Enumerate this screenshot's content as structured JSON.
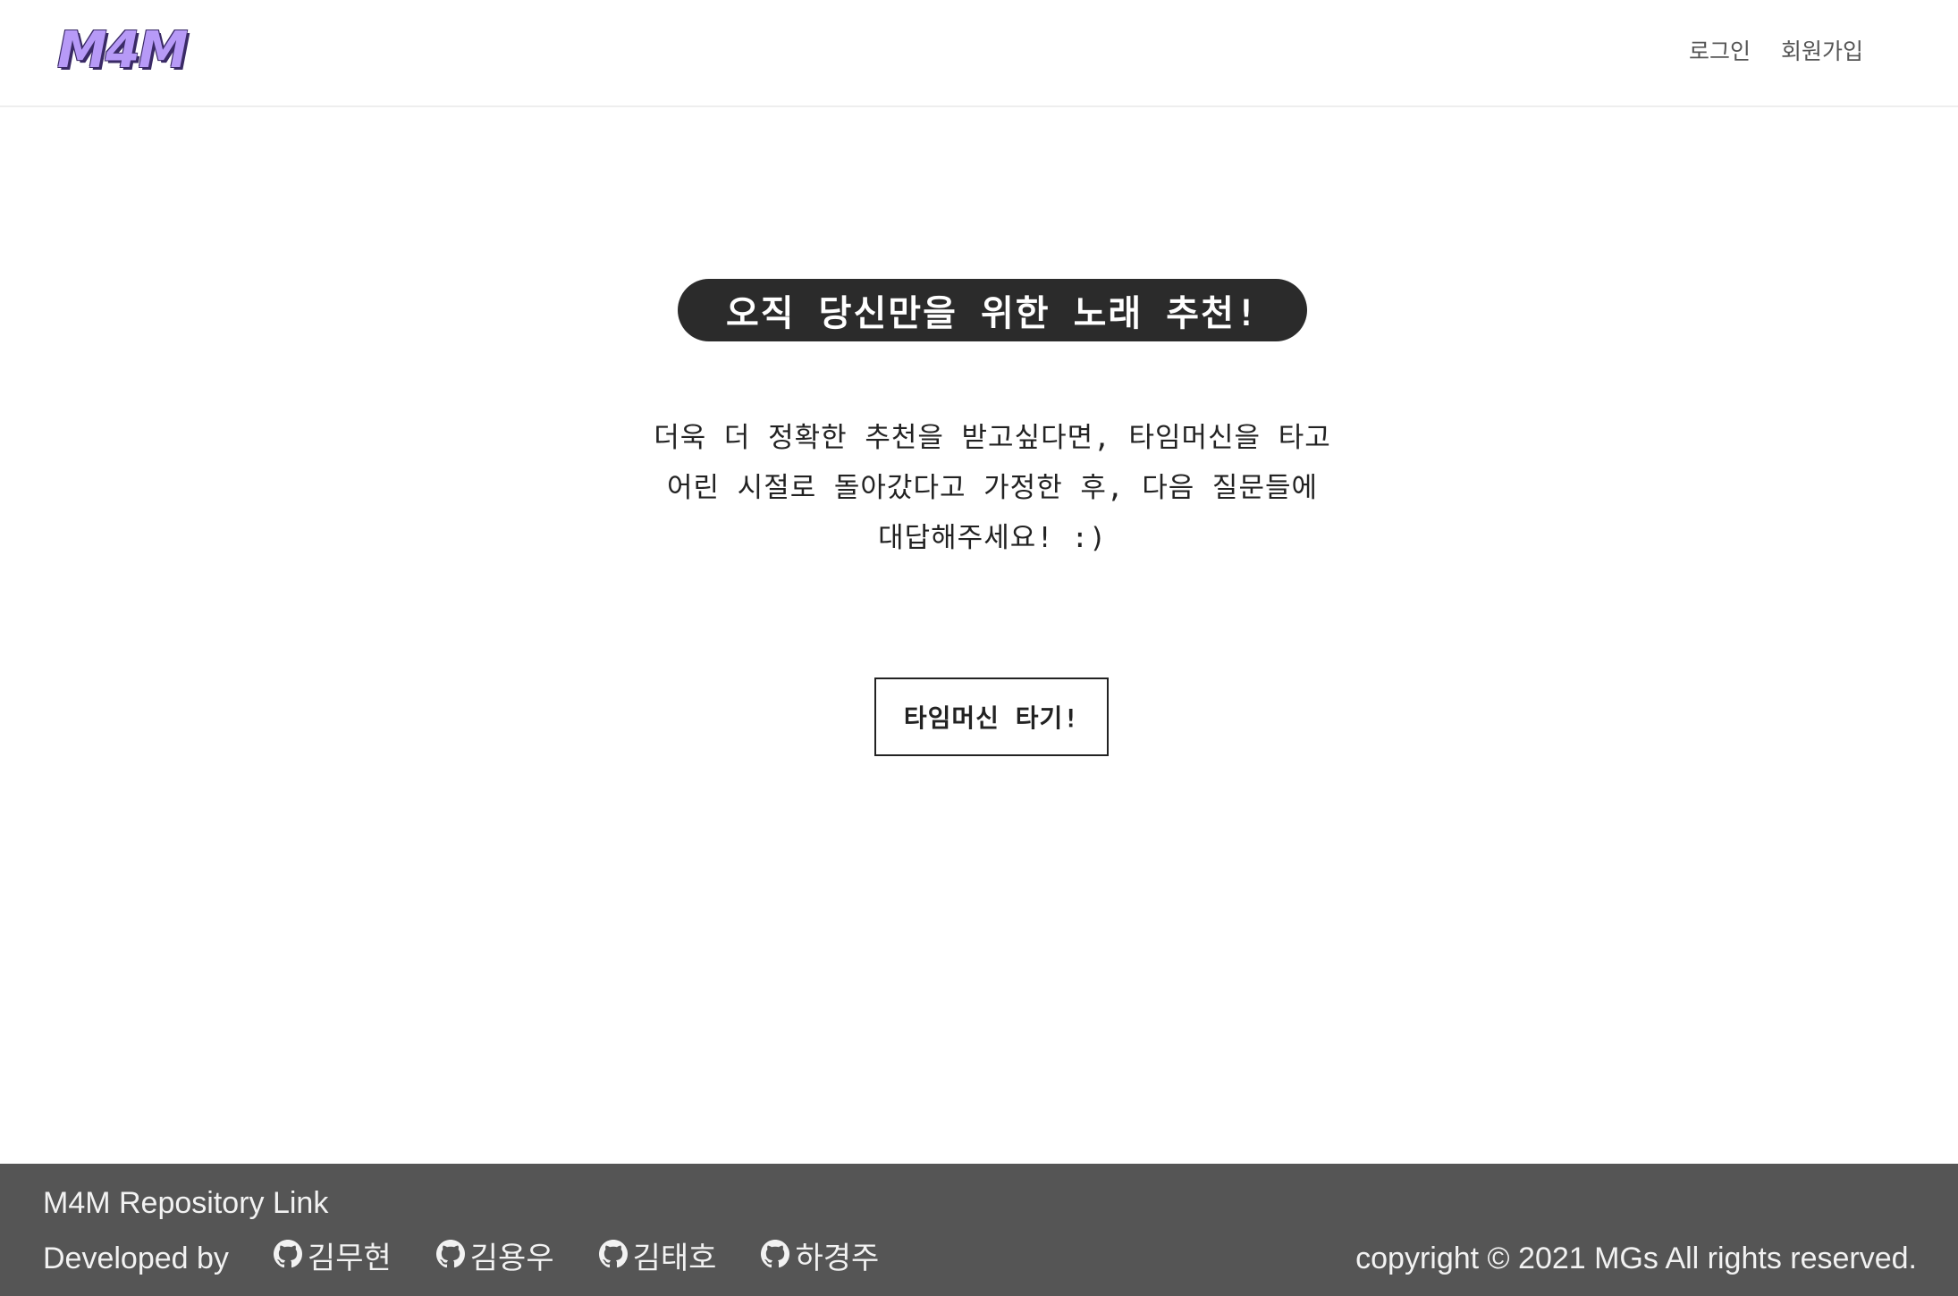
{
  "header": {
    "logo": "M4M",
    "nav": {
      "login": "로그인",
      "signup": "회원가입"
    }
  },
  "main": {
    "banner": "오직 당신만을 위한 노래 추천!",
    "description_lines": [
      "더욱 더 정확한 추천을 받고싶다면, 타임머신을 타고",
      "어린 시절로 돌아갔다고 가정한 후, 다음 질문들에",
      "대답해주세요! :)"
    ],
    "cta": "타임머신 타기!"
  },
  "footer": {
    "repo_link": "M4M Repository Link",
    "developed_by": "Developed by",
    "developers": [
      {
        "name": "김무현",
        "icon": "github-icon"
      },
      {
        "name": "김용우",
        "icon": "github-icon"
      },
      {
        "name": "김태호",
        "icon": "github-icon"
      },
      {
        "name": "하경주",
        "icon": "github-icon"
      }
    ],
    "copyright": "copyright © 2021 MGs All rights reserved."
  },
  "colors": {
    "logo": "#b79af7",
    "banner_bg": "#2b2b2b",
    "footer_bg": "#555555"
  }
}
